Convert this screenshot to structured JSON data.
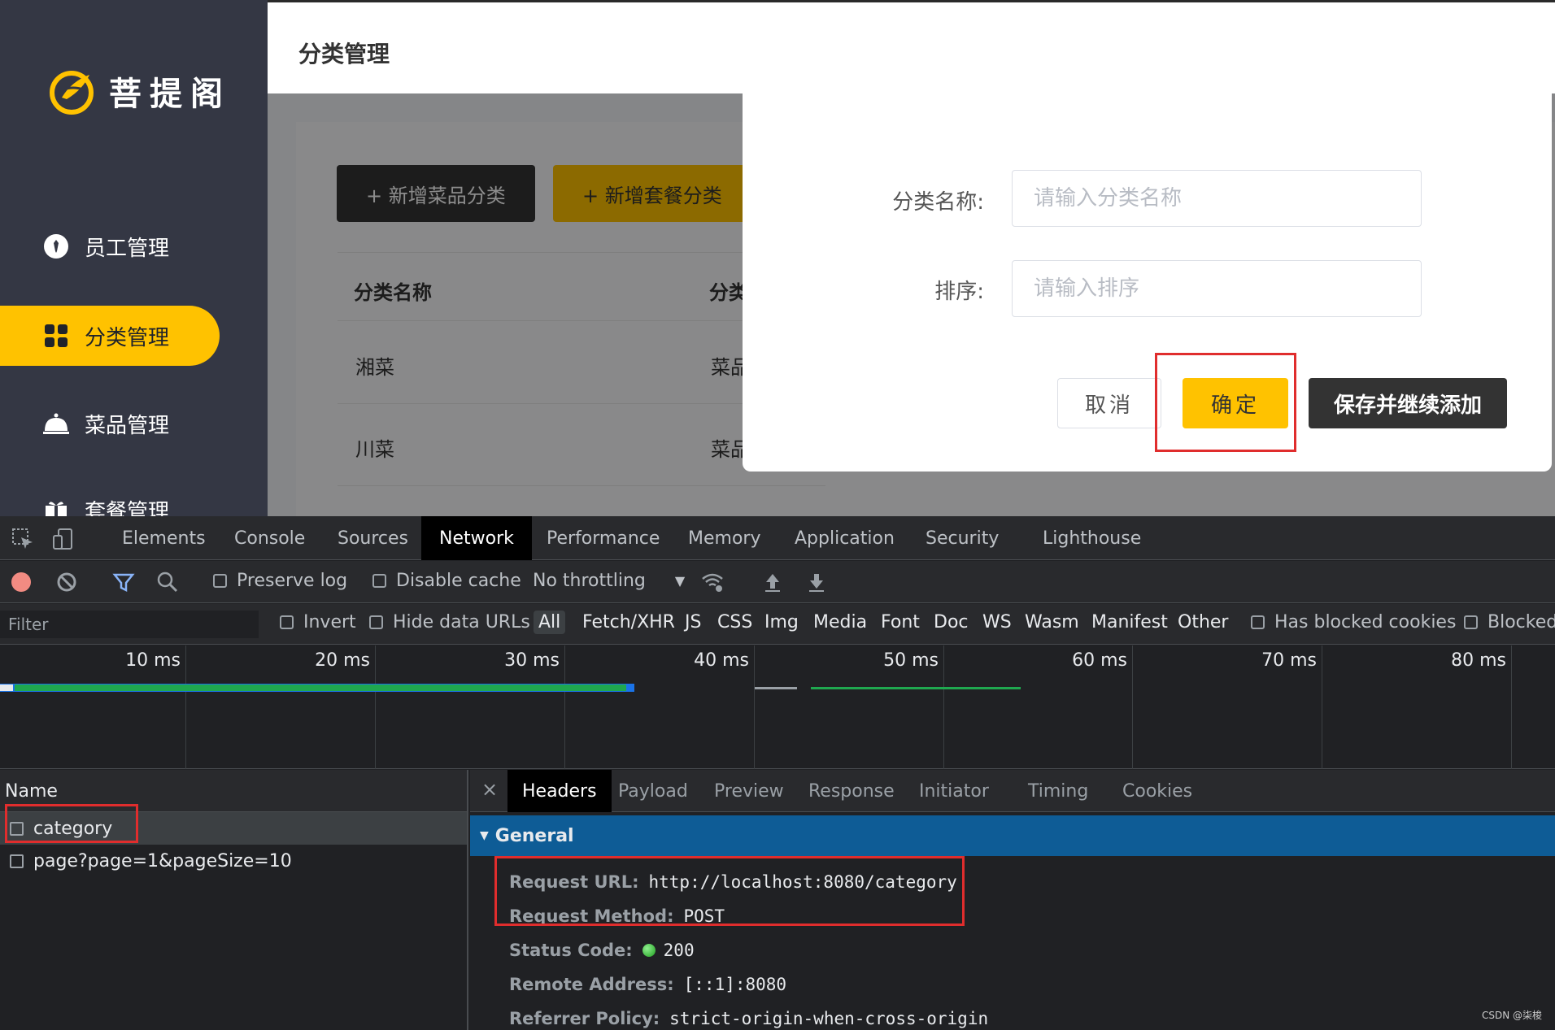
{
  "app": {
    "brand": "菩提阁",
    "page_title": "分类管理",
    "sidebar": {
      "items": [
        {
          "label": "员工管理"
        },
        {
          "label": "分类管理"
        },
        {
          "label": "菜品管理"
        },
        {
          "label": "套餐管理"
        }
      ]
    },
    "buttons": {
      "add_dish_category": "+ 新增菜品分类",
      "add_set_category": "+ 新增套餐分类"
    },
    "table": {
      "headers": [
        "分类名称",
        "分类"
      ],
      "rows": [
        [
          "湘菜",
          "菜品"
        ],
        [
          "川菜",
          "菜品"
        ]
      ]
    },
    "dialog": {
      "name_label": "分类名称:",
      "name_placeholder": "请输入分类名称",
      "sort_label": "排序:",
      "sort_placeholder": "请输入排序",
      "cancel": "取消",
      "confirm": "确定",
      "save_continue": "保存并继续添加"
    }
  },
  "devtools": {
    "tabs": [
      "Elements",
      "Console",
      "Sources",
      "Network",
      "Performance",
      "Memory",
      "Application",
      "Security",
      "Lighthouse"
    ],
    "toolbar": {
      "preserve_log": "Preserve log",
      "disable_cache": "Disable cache",
      "throttling": "No throttling"
    },
    "filter": {
      "placeholder": "Filter",
      "invert": "Invert",
      "hide_data_urls": "Hide data URLs",
      "types": [
        "All",
        "Fetch/XHR",
        "JS",
        "CSS",
        "Img",
        "Media",
        "Font",
        "Doc",
        "WS",
        "Wasm",
        "Manifest",
        "Other"
      ],
      "has_blocked_cookies": "Has blocked cookies",
      "blocked": "Blocked"
    },
    "timeline": {
      "ticks": [
        "10 ms",
        "20 ms",
        "30 ms",
        "40 ms",
        "50 ms",
        "60 ms",
        "70 ms",
        "80 ms"
      ]
    },
    "requests": {
      "header": "Name",
      "items": [
        "category",
        "page?page=1&pageSize=10"
      ]
    },
    "detail": {
      "close": "×",
      "tabs": [
        "Headers",
        "Payload",
        "Preview",
        "Response",
        "Initiator",
        "Timing",
        "Cookies"
      ],
      "section": "General",
      "fields": [
        {
          "key": "Request URL:",
          "value": "http://localhost:8080/category"
        },
        {
          "key": "Request Method:",
          "value": "POST"
        },
        {
          "key": "Status Code:",
          "value": "200"
        },
        {
          "key": "Remote Address:",
          "value": "[::1]:8080"
        },
        {
          "key": "Referrer Policy:",
          "value": "strict-origin-when-cross-origin"
        }
      ]
    }
  },
  "watermark": "CSDN @柒梭",
  "colors": {
    "sidebar": "#343744",
    "accent": "#ffc200",
    "highlight": "#e02d2d",
    "devtools_bg": "#202124",
    "general_bar": "#0e5c96"
  }
}
